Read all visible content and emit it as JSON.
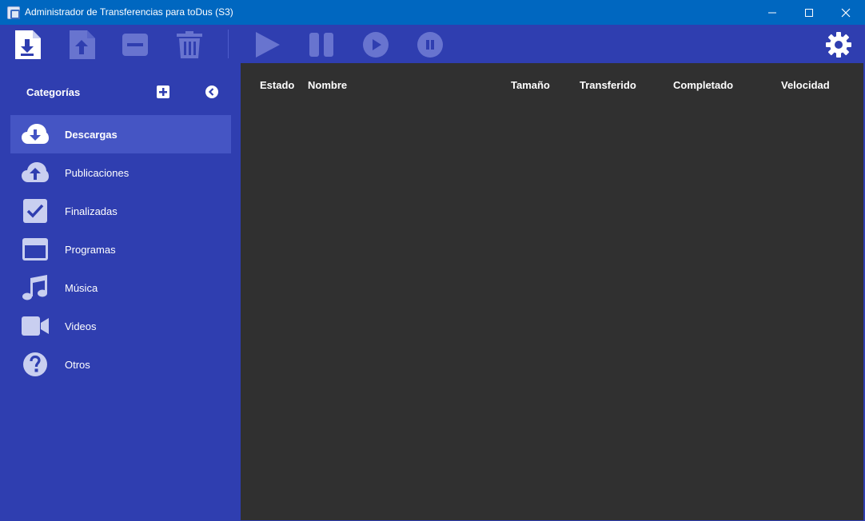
{
  "window": {
    "title": "Administrador de Transferencias para toDus (S3)"
  },
  "toolbar": {
    "buttons": [
      {
        "name": "download-button",
        "icon": "download-file-icon",
        "enabled": true
      },
      {
        "name": "upload-button",
        "icon": "upload-file-icon",
        "enabled": false
      },
      {
        "name": "remove-button",
        "icon": "minus-box-icon",
        "enabled": false
      },
      {
        "name": "delete-button",
        "icon": "trash-icon",
        "enabled": false
      },
      {
        "name": "start-button",
        "icon": "play-icon",
        "enabled": false
      },
      {
        "name": "pause-button",
        "icon": "pause-icon",
        "enabled": false
      },
      {
        "name": "start-all-button",
        "icon": "play-circle-icon",
        "enabled": false
      },
      {
        "name": "pause-all-button",
        "icon": "pause-circle-icon",
        "enabled": false
      },
      {
        "name": "settings-button",
        "icon": "gear-icon",
        "enabled": true
      }
    ]
  },
  "sidebar": {
    "title": "Categorías",
    "items": [
      {
        "label": "Descargas",
        "icon": "cloud-download-icon",
        "active": true
      },
      {
        "label": "Publicaciones",
        "icon": "cloud-upload-icon",
        "active": false
      },
      {
        "label": "Finalizadas",
        "icon": "check-box-icon",
        "active": false
      },
      {
        "label": "Programas",
        "icon": "window-icon",
        "active": false
      },
      {
        "label": "Música",
        "icon": "music-note-icon",
        "active": false
      },
      {
        "label": "Videos",
        "icon": "video-camera-icon",
        "active": false
      },
      {
        "label": "Otros",
        "icon": "question-circle-icon",
        "active": false
      }
    ]
  },
  "table": {
    "columns": [
      "Estado",
      "Nombre",
      "Tamaño",
      "Transferido",
      "Completado",
      "Velocidad"
    ],
    "rows": []
  },
  "colors": {
    "titlebar": "#0067c0",
    "sidebar": "#2f3eb0",
    "active_item": "#4555c4",
    "main_bg": "#303030",
    "icon_light": "#c9cff0",
    "icon_disabled": "#6874cf"
  }
}
